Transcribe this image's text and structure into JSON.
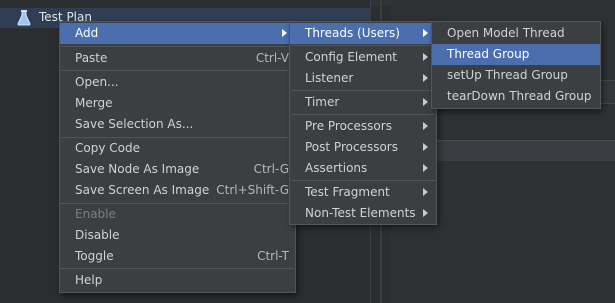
{
  "tree": {
    "root_label": "Test Plan",
    "root_icon": "flask-icon"
  },
  "context_menu": {
    "items": [
      {
        "label": "Add",
        "shortcut": "",
        "submenu": true,
        "selected": true,
        "disabled": false
      },
      {
        "label": "Paste",
        "shortcut": "Ctrl-V",
        "submenu": false,
        "selected": false,
        "disabled": false
      },
      {
        "label": "Open...",
        "shortcut": "",
        "submenu": false,
        "selected": false,
        "disabled": false
      },
      {
        "label": "Merge",
        "shortcut": "",
        "submenu": false,
        "selected": false,
        "disabled": false
      },
      {
        "label": "Save Selection As...",
        "shortcut": "",
        "submenu": false,
        "selected": false,
        "disabled": false
      },
      {
        "label": "Copy Code",
        "shortcut": "",
        "submenu": false,
        "selected": false,
        "disabled": false
      },
      {
        "label": "Save Node As Image",
        "shortcut": "Ctrl-G",
        "submenu": false,
        "selected": false,
        "disabled": false
      },
      {
        "label": "Save Screen As Image",
        "shortcut": "Ctrl+Shift-G",
        "submenu": false,
        "selected": false,
        "disabled": false
      },
      {
        "label": "Enable",
        "shortcut": "",
        "submenu": false,
        "selected": false,
        "disabled": true
      },
      {
        "label": "Disable",
        "shortcut": "",
        "submenu": false,
        "selected": false,
        "disabled": false
      },
      {
        "label": "Toggle",
        "shortcut": "Ctrl-T",
        "submenu": false,
        "selected": false,
        "disabled": false
      },
      {
        "label": "Help",
        "shortcut": "",
        "submenu": false,
        "selected": false,
        "disabled": false
      }
    ]
  },
  "add_submenu": {
    "items": [
      {
        "label": "Threads (Users)",
        "submenu": true,
        "selected": true
      },
      {
        "label": "Config Element",
        "submenu": true,
        "selected": false
      },
      {
        "label": "Listener",
        "submenu": true,
        "selected": false
      },
      {
        "label": "Timer",
        "submenu": true,
        "selected": false
      },
      {
        "label": "Pre Processors",
        "submenu": true,
        "selected": false
      },
      {
        "label": "Post Processors",
        "submenu": true,
        "selected": false
      },
      {
        "label": "Assertions",
        "submenu": true,
        "selected": false
      },
      {
        "label": "Test Fragment",
        "submenu": true,
        "selected": false
      },
      {
        "label": "Non-Test Elements",
        "submenu": true,
        "selected": false
      }
    ]
  },
  "threads_submenu": {
    "items": [
      {
        "label": "Open Model Thread Group",
        "selected": false
      },
      {
        "label": "Thread Group",
        "selected": true
      },
      {
        "label": "setUp Thread Group",
        "selected": false
      },
      {
        "label": "tearDown Thread Group",
        "selected": false
      }
    ]
  },
  "colors": {
    "menu_bg": "#3c3f41",
    "selection": "#4b6eaf",
    "text": "#cfd3d6",
    "disabled": "#7a7e82"
  }
}
